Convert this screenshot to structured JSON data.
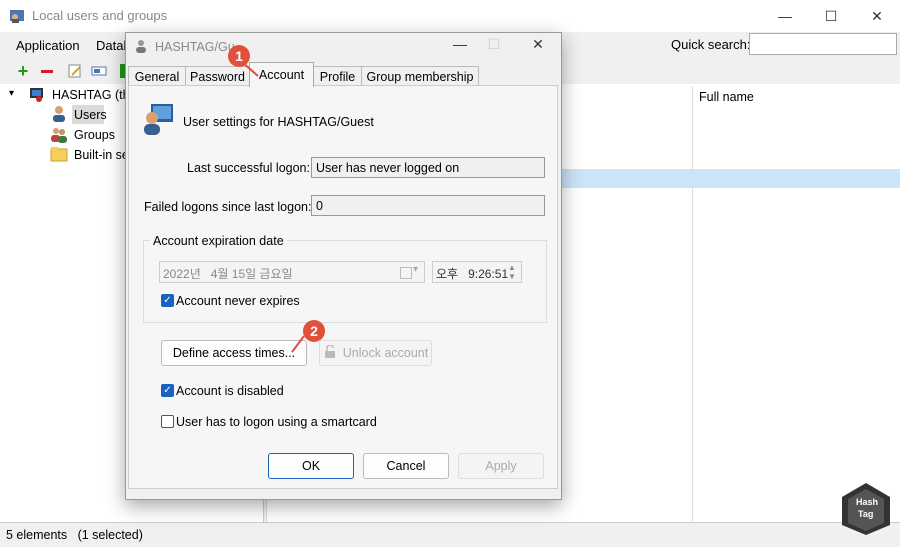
{
  "app": {
    "title": "Local users and groups",
    "menu": [
      "Application",
      "Datab"
    ],
    "quick_search_label": "Quick search:",
    "quick_search_value": ""
  },
  "window_controls": {
    "minimize": "—",
    "maximize": "☐",
    "close": "✕"
  },
  "tree": {
    "root": "HASHTAG (thi",
    "items": [
      "Users",
      "Groups",
      "Built-in se"
    ]
  },
  "list": {
    "col_fullname": "Full name"
  },
  "status": {
    "text": "5 elements   (1 selected)"
  },
  "dialog": {
    "title": "HASHTAG/Gu",
    "tabs": [
      "General",
      "Password",
      "Account",
      "Profile",
      "Group membership"
    ],
    "active_tab": "Account",
    "heading": "User settings for HASHTAG/Guest",
    "last_logon_label": "Last successful logon:",
    "last_logon_value": "User has never logged on",
    "failed_label": "Failed logons since last logon:",
    "failed_value": "0",
    "expiration_group": "Account expiration date",
    "date_value": "2022년   4월 15일 금요일",
    "time_value": "오후   9:26:51",
    "never_expires_label": "Account never expires",
    "never_expires_checked": true,
    "define_access_label": "Define access times...",
    "unlock_label": "Unlock account",
    "disabled_label": "Account is disabled",
    "disabled_checked": true,
    "smartcard_label": "User has to logon using a smartcard",
    "smartcard_checked": false,
    "ok_label": "OK",
    "cancel_label": "Cancel",
    "apply_label": "Apply"
  },
  "annotations": {
    "badge1": "1",
    "badge2": "2"
  },
  "logo": {
    "line1": "Hash",
    "line2": "Tag"
  },
  "colors": {
    "accent": "#1a62c2",
    "selection": "#cce4f7",
    "badge": "#e0503a"
  }
}
